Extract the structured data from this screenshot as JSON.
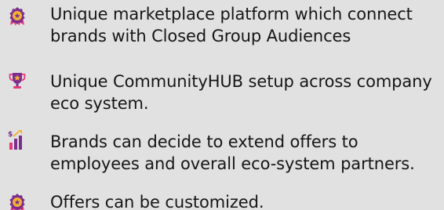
{
  "features": [
    {
      "icon": "award-badge-icon",
      "text": "Unique marketplace platform which connect\nbrands with Closed Group Audiences"
    },
    {
      "icon": "trophy-icon",
      "text": "Unique CommunityHUB setup across company\neco system."
    },
    {
      "icon": "growth-chart-icon",
      "text": "Brands can decide to extend offers to\nemployees and overall eco-system partners."
    },
    {
      "icon": "award-badge-icon",
      "text": "Offers can be customized."
    }
  ],
  "colors": {
    "background": "#e1e1e1",
    "text": "#161616",
    "icon_purple": "#7b2e8e",
    "icon_pink": "#e5397a",
    "icon_gold": "#f2b233"
  }
}
